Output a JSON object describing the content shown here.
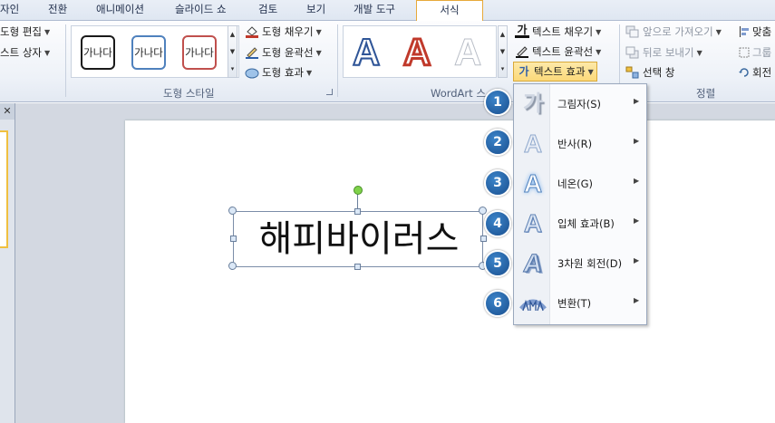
{
  "tabs": [
    {
      "label": "자인",
      "active": false
    },
    {
      "label": "전환",
      "active": false
    },
    {
      "label": "애니메이션",
      "active": false
    },
    {
      "label": "슬라이드 쇼",
      "active": false
    },
    {
      "label": "검토",
      "active": false
    },
    {
      "label": "보기",
      "active": false
    },
    {
      "label": "개발 도구",
      "active": false
    },
    {
      "label": "서식",
      "active": true
    }
  ],
  "insert_group": {
    "edit_shape": "도형 편집",
    "text_box": "스트 상자"
  },
  "shape_styles": {
    "group_label": "도형 스타일",
    "gallery": [
      {
        "label": "가나다",
        "border_color": "#1a1a1a"
      },
      {
        "label": "가나다",
        "border_color": "#4f81bd"
      },
      {
        "label": "가나다",
        "border_color": "#c0504d"
      }
    ],
    "fill": "도형 채우기",
    "outline": "도형 윤곽선",
    "effects": "도형 효과"
  },
  "wordart": {
    "group_label": "WordArt 스",
    "gallery": [
      {
        "letter": "A",
        "style": "blue-outline"
      },
      {
        "letter": "A",
        "style": "red-outline"
      },
      {
        "letter": "A",
        "style": "white-outline"
      }
    ],
    "text_fill": "텍스트 채우기",
    "text_outline": "텍스트 윤곽선",
    "text_effects": "텍스트 효과"
  },
  "arrange": {
    "group_label": "정렬",
    "bring_forward": "앞으로 가져오기",
    "send_backward": "뒤로 보내기",
    "selection_pane": "선택 창",
    "align": "맞춤",
    "group": "그룹",
    "rotate": "회전"
  },
  "slide": {
    "textbox_text": "해피바이러스"
  },
  "text_effects_menu": {
    "items": [
      {
        "number": "1",
        "label": "그림자(S)",
        "icon": "shadow-icon"
      },
      {
        "number": "2",
        "label": "반사(R)",
        "icon": "reflection-icon"
      },
      {
        "number": "3",
        "label": "네온(G)",
        "icon": "glow-icon"
      },
      {
        "number": "4",
        "label": "입체 효과(B)",
        "icon": "bevel-icon"
      },
      {
        "number": "5",
        "label": "3차원 회전(D)",
        "icon": "3d-rotation-icon"
      },
      {
        "number": "6",
        "label": "변환(T)",
        "icon": "transform-icon"
      }
    ]
  },
  "colors": {
    "active_tab_border": "#e7a93a",
    "badge": "#1f5fa8",
    "rotation_handle": "#7fd24a",
    "text_effects_highlight": "#fbd97a"
  }
}
